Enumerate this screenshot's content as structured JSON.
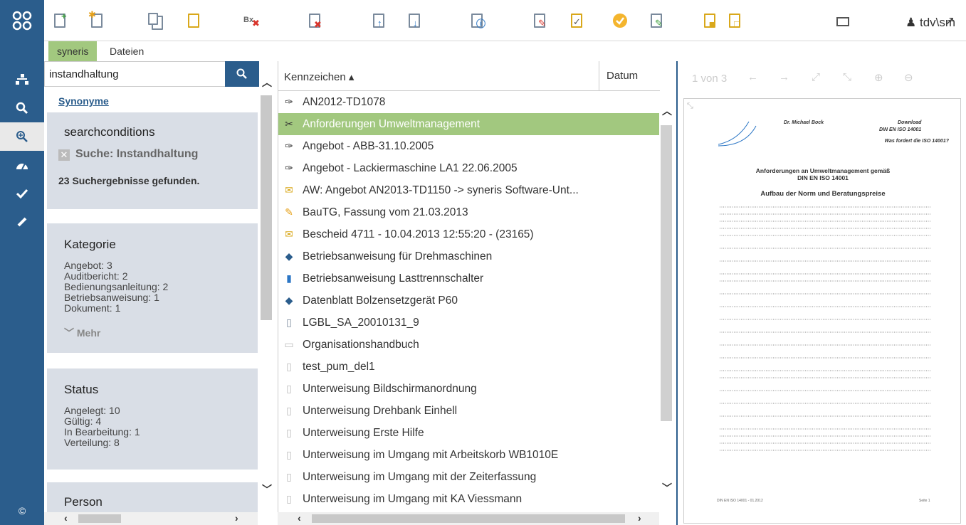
{
  "toolbar": {
    "user": "tdv\\sm"
  },
  "tabs": [
    {
      "label": "syneris"
    },
    {
      "label": "Dateien"
    }
  ],
  "search": {
    "value": "instandhaltung"
  },
  "left": {
    "synonyme": "Synonyme",
    "searchconditions": "searchconditions",
    "suche": "Suche: Instandhaltung",
    "results": "23 Suchergebnisse gefunden.",
    "kategorie": {
      "title": "Kategorie",
      "items": [
        "Angebot: 3",
        "Auditbericht: 2",
        "Bedienungsanleitung: 2",
        "Betriebsanweisung: 1",
        "Dokument: 1"
      ],
      "more": "Mehr"
    },
    "status": {
      "title": "Status",
      "items": [
        "Angelegt: 10",
        "Gültig: 4",
        "In Bearbeitung: 1",
        "Verteilung: 8"
      ]
    },
    "person": {
      "title": "Person"
    }
  },
  "list": {
    "col_kennzeichen": "Kennzeichen ▴",
    "col_datum": "Datum",
    "rows": [
      "AN2012-TD1078",
      "Anforderungen Umweltmanagement",
      "Angebot - ABB-31.10.2005",
      "Angebot - Lackiermaschine LA1 22.06.2005",
      "AW: Angebot AN2013-TD1150 -> syneris Software-Unt...",
      "BauTG, Fassung vom 21.03.2013",
      "Bescheid 4711 - 10.04.2013 12:55:20 - (23165)",
      "Betriebsanweisung für Drehmaschinen",
      "Betriebsanweisung Lasttrennschalter",
      "Datenblatt Bolzensetzgerät P60",
      "LGBL_SA_20010131_9",
      "Organisationshandbuch",
      "test_pum_del1",
      "Unterweisung Bildschirmanordnung",
      "Unterweisung Drehbank Einhell",
      "Unterweisung Erste Hilfe",
      "Unterweisung im Umgang mit Arbeitskorb WB1010E",
      "Unterweisung im Umgang mit der Zeiterfassung",
      "Unterweisung im Umgang mit KA Viessmann"
    ]
  },
  "preview": {
    "pager": "1 von 3",
    "doc": {
      "author": "Dr. Michael Bock",
      "download": "Download",
      "download2": "DIN EN ISO 14001",
      "question": "Was fordert die ISO 14001?",
      "title1": "Anforderungen an Umweltmanagement gemäß",
      "title2": "DIN EN ISO 14001",
      "subtitle": "Aufbau der Norm und Beratungspreise",
      "footer_left": "DIN EN ISO 14001 - 01.2012",
      "footer_right": "Seite 1"
    }
  }
}
